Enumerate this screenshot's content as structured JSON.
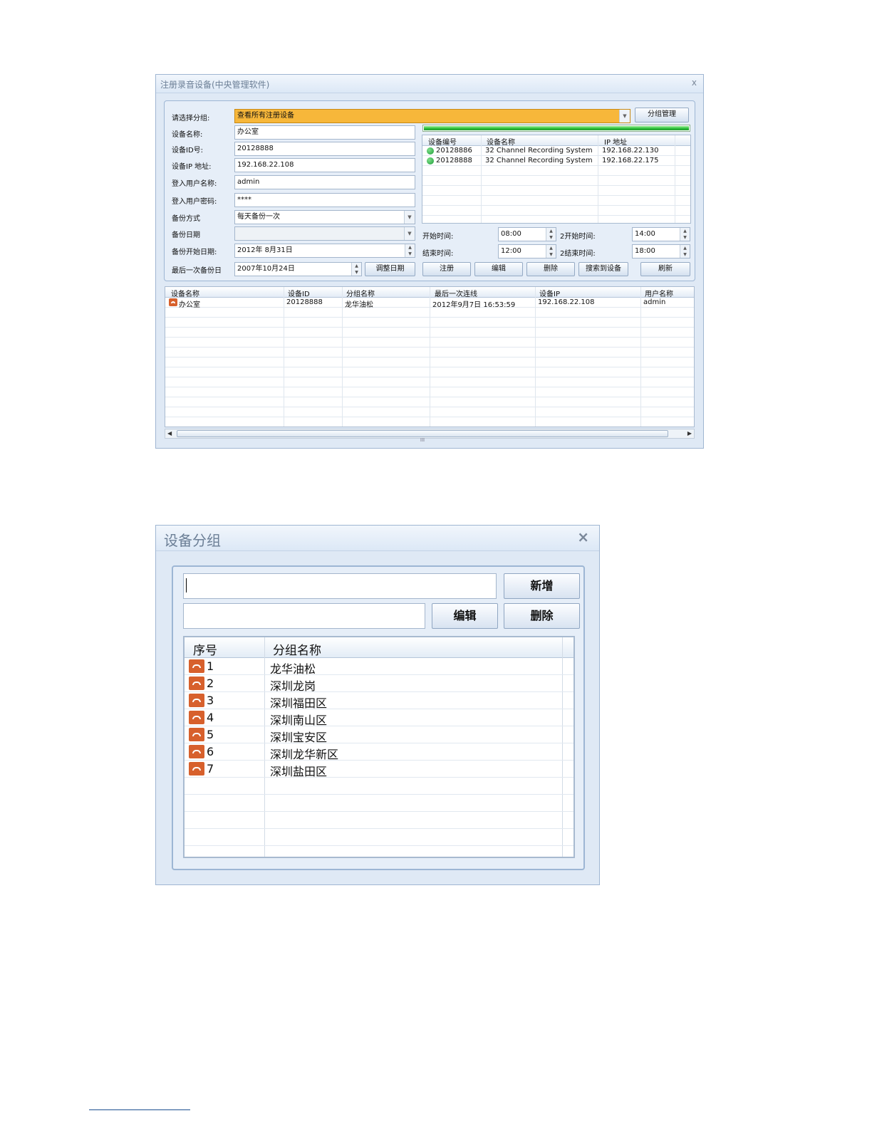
{
  "register_dialog": {
    "title": "注册录音设备(中央管理软件)",
    "close": "x",
    "labels": {
      "group": "请选择分组:",
      "device_name": "设备名称:",
      "device_id": "设备ID号:",
      "device_ip": "设备IP 地址:",
      "login_user": "登入用户名称:",
      "login_password": "登入用户密码:",
      "backup_mode": "备份方式",
      "backup_date": "备份日期",
      "backup_start_date": "备份开始日期:",
      "last_backup": "最后一次备份日"
    },
    "values": {
      "group": "查看所有注册设备",
      "device_name": "办公室",
      "device_id": "20128888",
      "device_ip": "192.168.22.108",
      "login_user": "admin",
      "login_password": "****",
      "backup_mode": "每天备份一次",
      "backup_date": "",
      "backup_start_date": "2012年  8月31日",
      "last_backup": "2007年10月24日"
    },
    "buttons": {
      "group_manage": "分组管理",
      "adjust_date": "调整日期",
      "register": "注册",
      "edit": "编辑",
      "delete": "删除",
      "searched_devices": "搜索到设备",
      "refresh": "刷新"
    },
    "found_devices": {
      "progress": 1.0,
      "columns": [
        "设备编号",
        "设备名称",
        "IP 地址"
      ],
      "rows": [
        {
          "id": "20128886",
          "name": "32 Channel Recording System",
          "ip": "192.168.22.130"
        },
        {
          "id": "20128888",
          "name": "32 Channel Recording System",
          "ip": "192.168.22.175"
        }
      ]
    },
    "time": {
      "start_label": "开始时间:",
      "start_value": "08:00",
      "end_label": "结束时间:",
      "end_value": "12:00",
      "start2_label": "2开始时间:",
      "start2_value": "14:00",
      "end2_label": "2结束时间:",
      "end2_value": "18:00"
    },
    "registered": {
      "columns": [
        "设备名称",
        "设备ID",
        "分组名称",
        "最后一次连线",
        "设备IP",
        "用户名称"
      ],
      "rows": [
        {
          "name": "办公室",
          "id": "20128888",
          "group": "龙华油松",
          "last": "2012年9月7日 16:53:59",
          "ip": "192.168.22.108",
          "user": "admin"
        }
      ],
      "scroll_mark": "III"
    }
  },
  "group_dialog": {
    "title": "设备分组",
    "close": "×",
    "input_top": "",
    "input_second": "",
    "buttons": {
      "add": "新增",
      "edit": "编辑",
      "delete": "删除"
    },
    "columns": [
      "序号",
      "分组名称"
    ],
    "rows": [
      {
        "no": "1",
        "name": "龙华油松"
      },
      {
        "no": "2",
        "name": "深圳龙岗"
      },
      {
        "no": "3",
        "name": "深圳福田区"
      },
      {
        "no": "4",
        "name": "深圳南山区"
      },
      {
        "no": "5",
        "name": "深圳宝安区"
      },
      {
        "no": "6",
        "name": "深圳龙华新区"
      },
      {
        "no": "7",
        "name": "深圳盐田区"
      }
    ]
  }
}
